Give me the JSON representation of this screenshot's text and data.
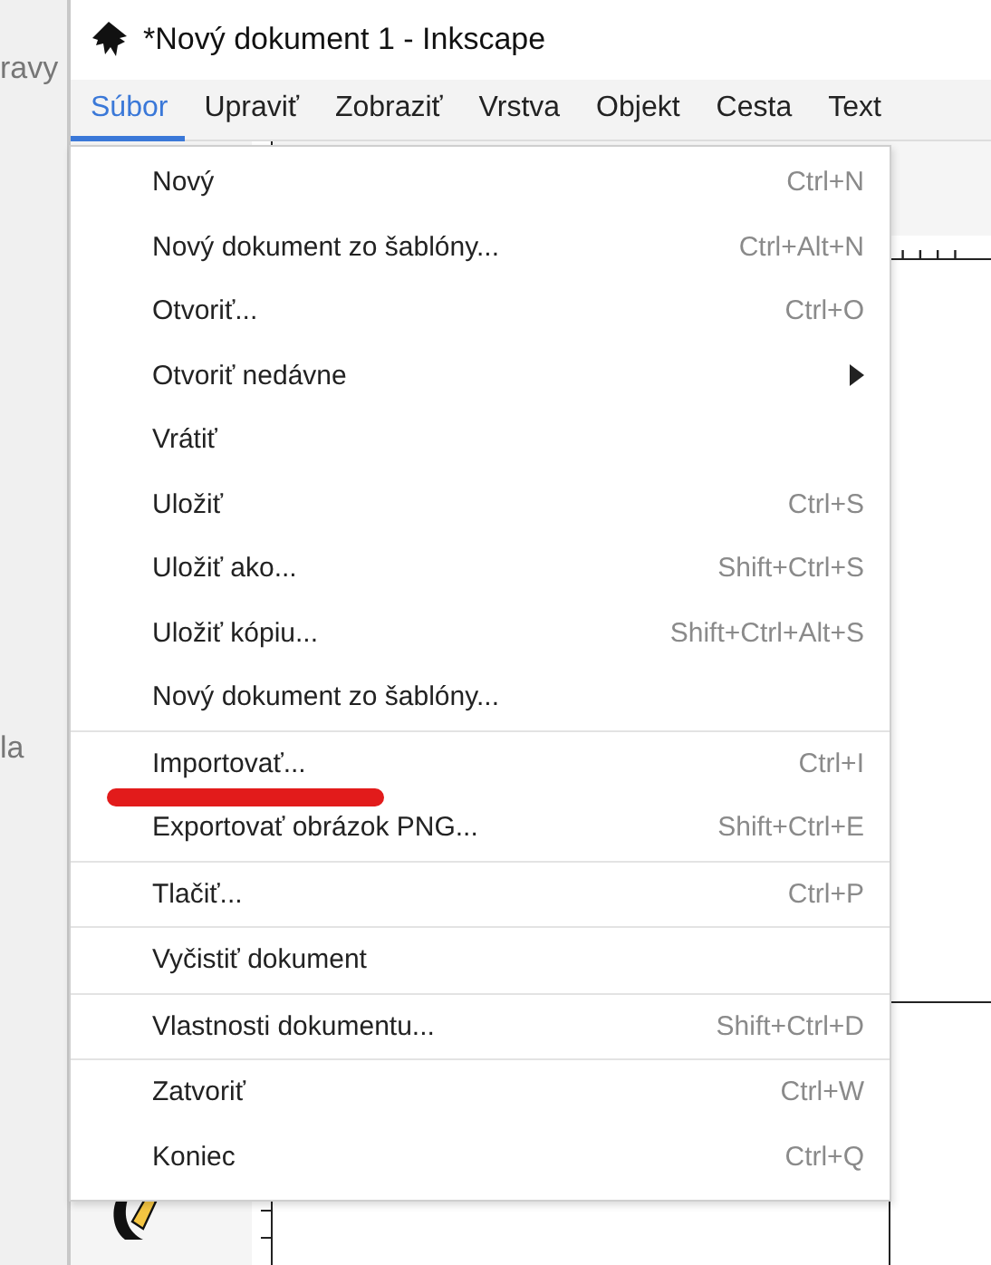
{
  "background_window": {
    "fragments": [
      "ravy",
      "la"
    ]
  },
  "window": {
    "title": "*Nový dokument 1 - Inkscape"
  },
  "menubar": [
    {
      "label": "Súbor",
      "selected": true
    },
    {
      "label": "Upraviť",
      "selected": false
    },
    {
      "label": "Zobraziť",
      "selected": false
    },
    {
      "label": "Vrstva",
      "selected": false
    },
    {
      "label": "Objekt",
      "selected": false
    },
    {
      "label": "Cesta",
      "selected": false
    },
    {
      "label": "Text",
      "selected": false
    }
  ],
  "menu": {
    "sections": [
      [
        {
          "label": "Nový",
          "shortcut": "Ctrl+N",
          "submenu": false,
          "marked": false
        },
        {
          "label": "Nový dokument zo šablóny...",
          "shortcut": "Ctrl+Alt+N",
          "submenu": false,
          "marked": false
        },
        {
          "label": "Otvoriť...",
          "shortcut": "Ctrl+O",
          "submenu": false,
          "marked": false
        },
        {
          "label": "Otvoriť nedávne",
          "submenu": true,
          "marked": false
        },
        {
          "label": "Vrátiť",
          "submenu": false,
          "marked": false
        },
        {
          "label": "Uložiť",
          "shortcut": "Ctrl+S",
          "submenu": false,
          "marked": false
        },
        {
          "label": "Uložiť ako...",
          "shortcut": "Shift+Ctrl+S",
          "submenu": false,
          "marked": false
        },
        {
          "label": "Uložiť kópiu...",
          "shortcut": "Shift+Ctrl+Alt+S",
          "submenu": false,
          "marked": false
        },
        {
          "label": "Nový dokument zo šablóny...",
          "submenu": false,
          "marked": false
        }
      ],
      [
        {
          "label": "Importovať...",
          "shortcut": "Ctrl+I",
          "submenu": false,
          "marked": true
        },
        {
          "label": "Exportovať obrázok PNG...",
          "shortcut": "Shift+Ctrl+E",
          "submenu": false,
          "marked": false
        }
      ],
      [
        {
          "label": "Tlačiť...",
          "shortcut": "Ctrl+P",
          "submenu": false,
          "marked": false
        }
      ],
      [
        {
          "label": "Vyčistiť dokument",
          "submenu": false,
          "marked": false
        }
      ],
      [
        {
          "label": "Vlastnosti dokumentu...",
          "shortcut": "Shift+Ctrl+D",
          "submenu": false,
          "marked": false
        }
      ],
      [
        {
          "label": "Zatvoriť",
          "shortcut": "Ctrl+W",
          "submenu": false,
          "marked": false
        },
        {
          "label": "Koniec",
          "shortcut": "Ctrl+Q",
          "submenu": false,
          "marked": false
        }
      ]
    ]
  }
}
